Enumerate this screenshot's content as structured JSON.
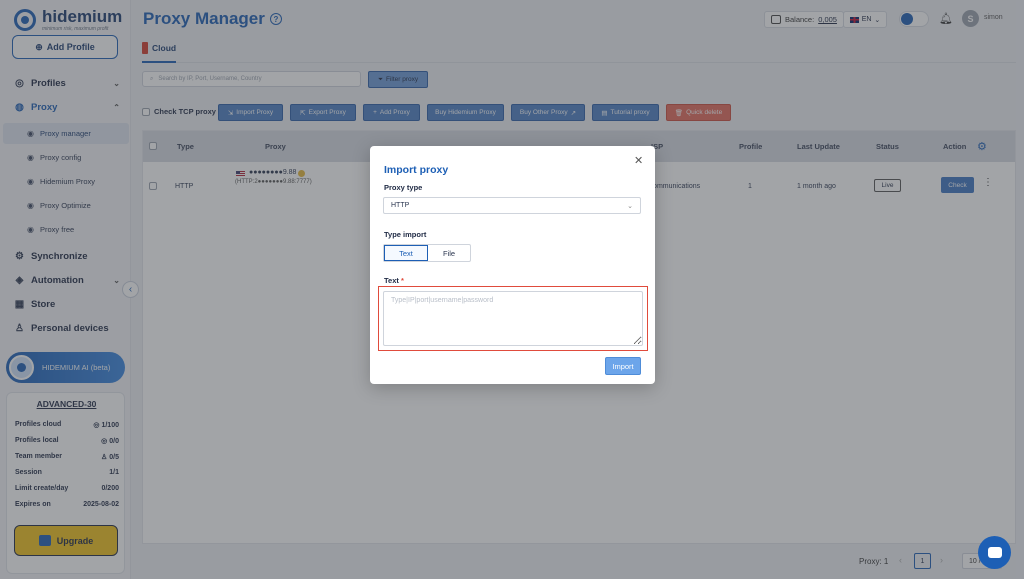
{
  "app": {
    "logo_name": "hidemium",
    "logo_tagline": "minimum risk, maximum profit"
  },
  "sidebar": {
    "add_profile": "Add Profile",
    "nav": [
      {
        "label": "Profiles",
        "icon": "profiles-icon"
      },
      {
        "label": "Proxy",
        "icon": "proxy-globe-icon"
      },
      {
        "label": "Synchronize",
        "icon": "synchronize-icon"
      },
      {
        "label": "Automation",
        "icon": "automation-icon"
      },
      {
        "label": "Store",
        "icon": "store-icon"
      },
      {
        "label": "Personal devices",
        "icon": "personal-devices-icon"
      }
    ],
    "proxy_sub": [
      "Proxy manager",
      "Proxy config",
      "Hidemium Proxy",
      "Proxy Optimize",
      "Proxy free"
    ],
    "ai_label": "HIDEMIUM AI (beta)",
    "plan": {
      "title": "ADVANCED-30",
      "rows": [
        {
          "label": "Profiles cloud",
          "value": "1/100"
        },
        {
          "label": "Profiles local",
          "value": "0/0"
        },
        {
          "label": "Team member",
          "value": "0/5"
        },
        {
          "label": "Session",
          "value": "1/1"
        },
        {
          "label": "Limit create/day",
          "value": "0/200"
        },
        {
          "label": "Expires on",
          "value": "2025-08-02"
        }
      ],
      "upgrade": "Upgrade"
    }
  },
  "header": {
    "title": "Proxy Manager",
    "balance_label": "Balance:",
    "balance_value": "0,005",
    "language": "EN",
    "user_initial": "S",
    "user_name": "simon"
  },
  "tabs": {
    "cloud": "Cloud"
  },
  "toolbar": {
    "search_placeholder": "Search by IP, Port, Username, Country",
    "filter": "Filter proxy",
    "check_tcp": "Check TCP proxy",
    "import": "Import Proxy",
    "export": "Export Proxy",
    "add": "Add Proxy",
    "buy_hidemium": "Buy Hidemium Proxy",
    "buy_other": "Buy Other Proxy",
    "tutorial": "Tutorial proxy",
    "quick_delete": "Quick delete"
  },
  "table": {
    "headers": {
      "type": "Type",
      "proxy": "Proxy",
      "isp": "ISP",
      "profile": "Profile",
      "last_update": "Last Update",
      "status": "Status",
      "action": "Action"
    },
    "row": {
      "type": "HTTP",
      "proxy_ip": "●●●●●●●●9.88",
      "proxy_detail": "(HTTP:2●●●●●●●9.88:7777)",
      "isp": "Communications",
      "profile": "1",
      "last_update": "1 month ago",
      "status": "Live",
      "check": "Check"
    }
  },
  "pager": {
    "label": "Proxy: 1",
    "page": "1",
    "size": "10 /"
  },
  "modal": {
    "title": "Import proxy",
    "proxy_type_label": "Proxy type",
    "proxy_type_value": "HTTP",
    "type_import_label": "Type import",
    "type_import_options": [
      "Text",
      "File"
    ],
    "text_label": "Text",
    "required_mark": "*",
    "text_placeholder": "Type|IP|port|username|password",
    "import_button": "Import"
  },
  "colors": {
    "accent": "#1d5fb5",
    "danger": "#e04b3c",
    "upgrade": "#f2c11b"
  }
}
